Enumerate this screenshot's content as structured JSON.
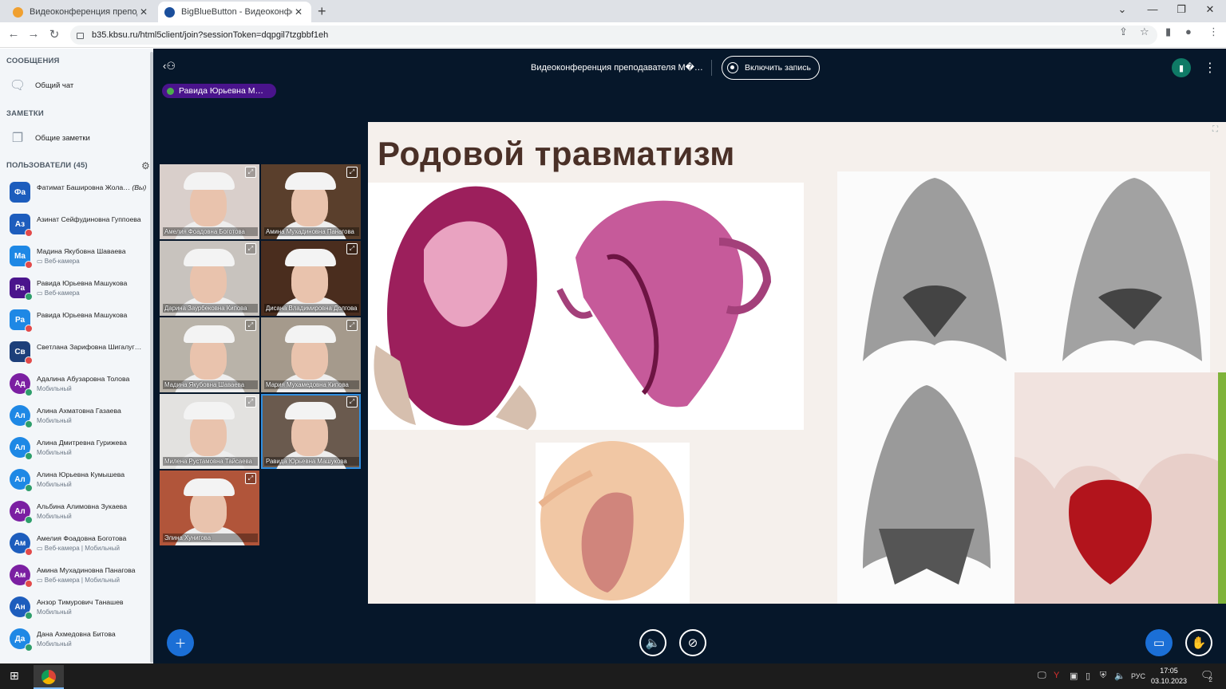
{
  "browser": {
    "tabs": [
      {
        "title": "Видеоконференция преподава",
        "favicon_color": "#f0a030",
        "active": false
      },
      {
        "title": "BigBlueButton - Видеоконфере",
        "favicon_color": "#1b4f9c",
        "active": true
      }
    ],
    "url": "b35.kbsu.ru/html5client/join?sessionToken=dqpgil7tzgbbf1eh",
    "new_tab": "+",
    "close": "✕"
  },
  "sidebar": {
    "messages_title": "СООБЩЕНИЯ",
    "public_chat": "Общий чат",
    "notes_title": "ЗАМЕТКИ",
    "shared_notes": "Общие заметки",
    "users_title": "ПОЛЬЗОВАТЕЛИ (45)",
    "users": [
      {
        "initials": "Фа",
        "name": "Фатимат Баширoвна Жола…",
        "you": "(Вы)",
        "sub": "",
        "color": "#1d5dbd",
        "badge": "",
        "shape": "square"
      },
      {
        "initials": "Аз",
        "name": "Азинат Сейфудиновна Гуппоева",
        "sub": "",
        "color": "#1d5dbd",
        "badge": "#e24a4a",
        "shape": "square"
      },
      {
        "initials": "Ма",
        "name": "Мадина Якубовна Шаваева",
        "sub": "▭ Веб-камера",
        "color": "#1e88e5",
        "badge": "#e24a4a",
        "shape": "square"
      },
      {
        "initials": "Ра",
        "name": "Равида Юрьевна Машукова",
        "sub": "▭ Веб-камера",
        "color": "#4a148c",
        "badge": "#2e9e6b",
        "shape": "square"
      },
      {
        "initials": "Ра",
        "name": "Равида Юрьевна Машукова",
        "sub": "",
        "color": "#1e88e5",
        "badge": "#e24a4a",
        "shape": "square"
      },
      {
        "initials": "Св",
        "name": "Светлана Зарифовна Шигалуг…",
        "sub": "",
        "color": "#1d3f7a",
        "badge": "#e24a4a",
        "shape": "square"
      },
      {
        "initials": "Ад",
        "name": "Адалина Абузаровна Толова",
        "sub": "Мобильный",
        "color": "#7b1fa2",
        "badge": "#2e9e6b",
        "shape": "round"
      },
      {
        "initials": "Ал",
        "name": "Алина Ахматовна Газаева",
        "sub": "Мобильный",
        "color": "#1e88e5",
        "badge": "#2e9e6b",
        "shape": "round"
      },
      {
        "initials": "Ал",
        "name": "Алина Дмитревна Гурижева",
        "sub": "Мобильный",
        "color": "#1e88e5",
        "badge": "#2e9e6b",
        "shape": "round"
      },
      {
        "initials": "Ал",
        "name": "Алина Юрьевна Кумышева",
        "sub": "Мобильный",
        "color": "#1e88e5",
        "badge": "#2e9e6b",
        "shape": "round"
      },
      {
        "initials": "Ал",
        "name": "Альбина Алимовна Зукаева",
        "sub": "Мобильный",
        "color": "#7b1fa2",
        "badge": "#2e9e6b",
        "shape": "round"
      },
      {
        "initials": "Ам",
        "name": "Амелия Фоадовна Боготова",
        "sub": "▭ Веб-камера | Мобильный",
        "color": "#1d5dbd",
        "badge": "#e24a4a",
        "shape": "round"
      },
      {
        "initials": "Ам",
        "name": "Амина Мухадиновна Панагова",
        "sub": "▭ Веб-камера | Мобильный",
        "color": "#7b1fa2",
        "badge": "#e24a4a",
        "shape": "round"
      },
      {
        "initials": "Ан",
        "name": "Анзор Тимурович Танашев",
        "sub": "Мобильный",
        "color": "#1d5dbd",
        "badge": "#2e9e6b",
        "shape": "round"
      },
      {
        "initials": "Да",
        "name": "Дана Ахмедовна Битова",
        "sub": "Мобильный",
        "color": "#1e88e5",
        "badge": "#2e9e6b",
        "shape": "round"
      }
    ]
  },
  "header": {
    "title": "Видеоконференция преподавателя М�…",
    "record": "Включить запись",
    "talker": "Равида Юрьевна М…"
  },
  "videos": [
    {
      "name": "Амелия Фоадовна Боготова",
      "bg": "#d9cfcb"
    },
    {
      "name": "Амина Мухадиновна Панагова",
      "bg": "#5a3f2c"
    },
    {
      "name": "Дарина Заурбековна Кипова",
      "bg": "#c8c3be"
    },
    {
      "name": "Дисана Владимировна Долгова",
      "bg": "#4a2d1e"
    },
    {
      "name": "Мадина Якубовна Шаваева",
      "bg": "#b9b3a9"
    },
    {
      "name": "Мария Мухамедовна Кипова",
      "bg": "#a59a8c"
    },
    {
      "name": "Милена Рустамовна Тайсаева",
      "bg": "#e3e2e0"
    },
    {
      "name": "Равида Юрьевна Машукова",
      "bg": "#6a5a4e"
    },
    {
      "name": "Элина Хунигова",
      "bg": "#b1553a"
    }
  ],
  "slide": {
    "title": "Родовой травматизм"
  },
  "taskbar": {
    "time": "17:05",
    "date": "03.10.2023",
    "lang": "РУС",
    "notif": "2"
  }
}
